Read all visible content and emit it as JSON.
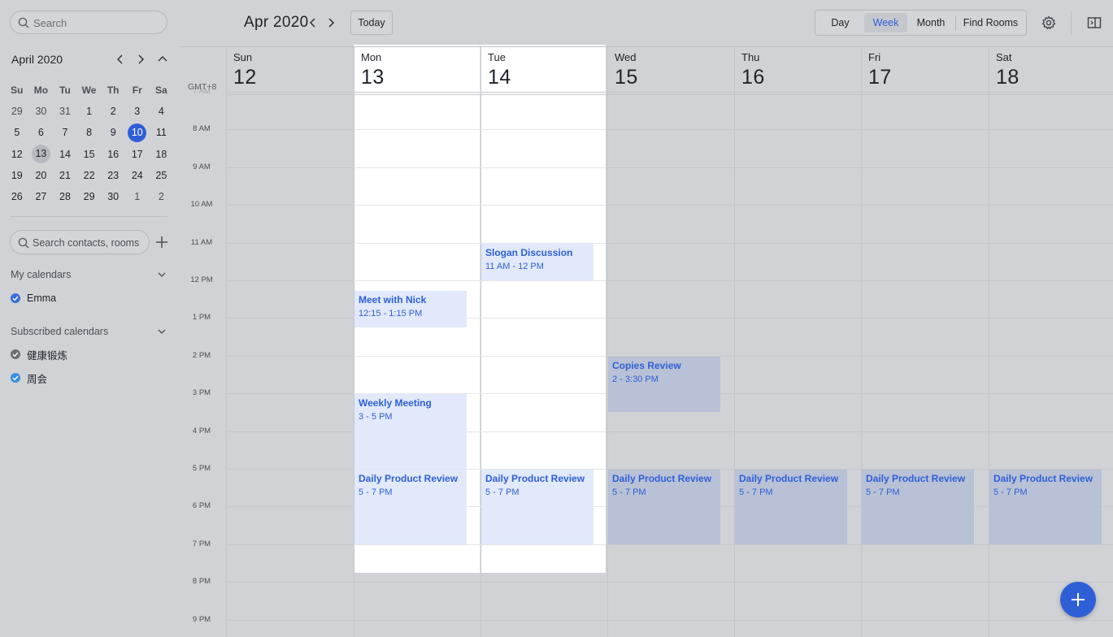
{
  "sidebar": {
    "search_placeholder": "Search",
    "mini_month_title": "April 2020",
    "weekday_headers": [
      "Su",
      "Mo",
      "Tu",
      "We",
      "Th",
      "Fr",
      "Sa"
    ],
    "weeks": [
      [
        "29",
        "30",
        "31",
        "1",
        "2",
        "3",
        "4"
      ],
      [
        "5",
        "6",
        "7",
        "8",
        "9",
        "10",
        "11"
      ],
      [
        "12",
        "13",
        "14",
        "15",
        "16",
        "17",
        "18"
      ],
      [
        "19",
        "20",
        "21",
        "22",
        "23",
        "24",
        "25"
      ],
      [
        "26",
        "27",
        "28",
        "29",
        "30",
        "1",
        "2"
      ]
    ],
    "today_date": "10",
    "selected_date": "13",
    "contacts_placeholder": "Search contacts, rooms",
    "my_calendars_label": "My calendars",
    "my_calendars": [
      {
        "label": "Emma",
        "color": "#3a6fd8"
      }
    ],
    "subscribed_label": "Subscribed calendars",
    "subscribed_calendars": [
      {
        "label": "健康锻炼",
        "color": "#6b6f76"
      },
      {
        "label": "周会",
        "color": "#3a8fe0"
      }
    ]
  },
  "header": {
    "month_title": "Apr 2020",
    "today_label": "Today",
    "views": [
      "Day",
      "Week",
      "Month",
      "Find Rooms"
    ],
    "active_view": "Week"
  },
  "calendar": {
    "timezone": "GMT+8",
    "days": [
      {
        "weekday": "Sun",
        "date": "12"
      },
      {
        "weekday": "Mon",
        "date": "13"
      },
      {
        "weekday": "Tue",
        "date": "14"
      },
      {
        "weekday": "Wed",
        "date": "15"
      },
      {
        "weekday": "Thu",
        "date": "16"
      },
      {
        "weekday": "Fri",
        "date": "17"
      },
      {
        "weekday": "Sat",
        "date": "18"
      }
    ],
    "time_labels": [
      "7 AM",
      "8 AM",
      "9 AM",
      "10 AM",
      "11 AM",
      "12 PM",
      "1 PM",
      "2 PM",
      "3 PM",
      "4 PM",
      "5 PM",
      "6 PM",
      "7 PM",
      "8 PM",
      "9 PM"
    ],
    "events": [
      {
        "title": "Slogan Discussion",
        "time": "11 AM - 12 PM",
        "day": 2,
        "start": 11,
        "end": 12,
        "style": "light"
      },
      {
        "title": "Meet with Nick",
        "time": "12:15 - 1:15 PM",
        "day": 1,
        "start": 12.25,
        "end": 13.25,
        "style": "light"
      },
      {
        "title": "Copies Review",
        "time": "2 - 3:30 PM",
        "day": 3,
        "start": 14,
        "end": 15.5,
        "style": "dark"
      },
      {
        "title": "Weekly Meeting",
        "time": "3 - 5 PM",
        "day": 1,
        "start": 15,
        "end": 17,
        "style": "light"
      },
      {
        "title": "Daily Product Review",
        "time": "5 - 7 PM",
        "day": 1,
        "start": 17,
        "end": 19,
        "style": "light"
      },
      {
        "title": "Daily Product Review",
        "time": "5 - 7 PM",
        "day": 2,
        "start": 17,
        "end": 19,
        "style": "light"
      },
      {
        "title": "Daily Product Review",
        "time": "5 - 7 PM",
        "day": 3,
        "start": 17,
        "end": 19,
        "style": "dark"
      },
      {
        "title": "Daily Product Review",
        "time": "5 - 7 PM",
        "day": 4,
        "start": 17,
        "end": 19,
        "style": "dark"
      },
      {
        "title": "Daily Product Review",
        "time": "5 - 7 PM",
        "day": 5,
        "start": 17,
        "end": 19,
        "style": "dark"
      },
      {
        "title": "Daily Product Review",
        "time": "5 - 7 PM",
        "day": 6,
        "start": 17,
        "end": 19,
        "style": "dark"
      }
    ]
  },
  "colors": {
    "accent": "#2f5fd6",
    "event_light": "#e1e9fb",
    "event_dark": "#b8c1d5"
  },
  "icons": [
    "search-icon",
    "chevron-left-icon",
    "chevron-right-icon",
    "chevron-up-icon",
    "plus-icon",
    "chevron-down-icon",
    "check-icon",
    "gear-icon",
    "side-panel-icon",
    "add-icon"
  ]
}
